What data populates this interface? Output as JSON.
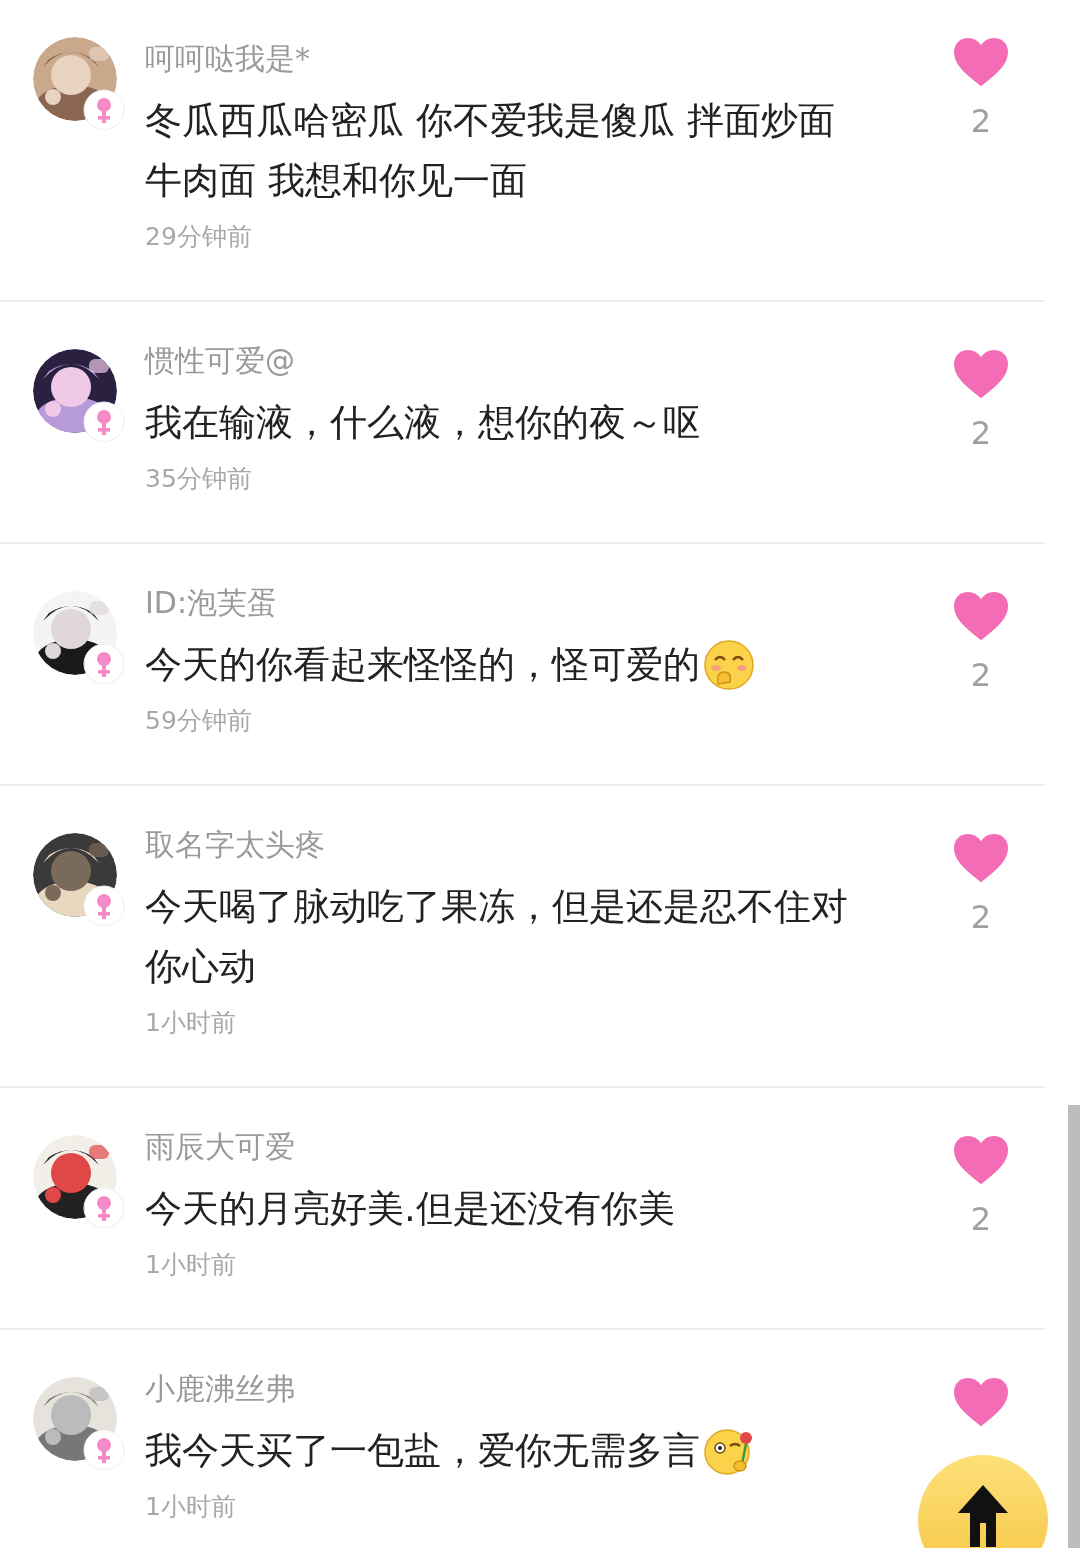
{
  "comments": [
    {
      "username": "呵呵哒我是*",
      "text": "冬瓜西瓜哈密瓜 你不爱我是傻瓜 拌面炒面牛肉面 我想和你见一面",
      "time": "29分钟前",
      "likes": "2",
      "liked": true,
      "badge": {
        "kind": "female"
      }
    },
    {
      "username": "惯性可爱@",
      "text": "我在输液，什么液，想你的夜～呕",
      "time": "35分钟前",
      "likes": "2",
      "liked": true,
      "badge": {
        "kind": "female"
      }
    },
    {
      "username": "ID:泡芙蛋",
      "text": "今天的你看起来怪怪的，怪可爱的",
      "emoji": {
        "kind": "shy"
      },
      "time": "59分钟前",
      "likes": "2",
      "liked": true,
      "badge": {
        "kind": "female"
      }
    },
    {
      "username": "取名字太头疼",
      "text": "今天喝了脉动吃了果冻，但是还是忍不住对你心动",
      "time": "1小时前",
      "likes": "2",
      "liked": true,
      "badge": {
        "kind": "female"
      }
    },
    {
      "username": "雨辰大可爱",
      "text": "今天的月亮好美.但是还没有你美",
      "time": "1小时前",
      "likes": "2",
      "liked": true,
      "badge": {
        "kind": "female"
      }
    },
    {
      "username": "小鹿沸丝弗",
      "text": "我今天买了一包盐，爱你无需多言",
      "emoji": {
        "kind": "flower"
      },
      "time": "1小时前",
      "liked": true,
      "badge": {
        "kind": "female"
      }
    }
  ]
}
